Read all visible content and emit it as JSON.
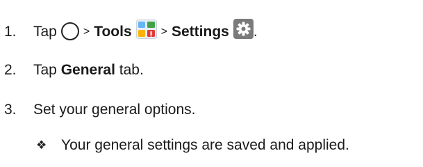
{
  "steps": [
    {
      "number": "1.",
      "tap": "Tap",
      "sep1": ">",
      "tools": "Tools",
      "sep2": ">",
      "settings": "Settings",
      "end": ".",
      "icons": [
        "home-circle-icon",
        "tools-folder-icon",
        "settings-gear-icon"
      ]
    },
    {
      "number": "2.",
      "tap": "Tap",
      "bold": "General",
      "rest": "tab."
    },
    {
      "number": "3.",
      "text": "Set your general options."
    }
  ],
  "result": {
    "icon": "diamond-bullet-icon",
    "symbol": "❖",
    "text": "Your general settings are saved and applied."
  },
  "colors": {
    "text": "#1a1a1a",
    "settings_icon_bg": "#7a7a7a",
    "tools_red": "#e53935",
    "tools_green": "#43a047",
    "tools_blue": "#64b5f6"
  }
}
